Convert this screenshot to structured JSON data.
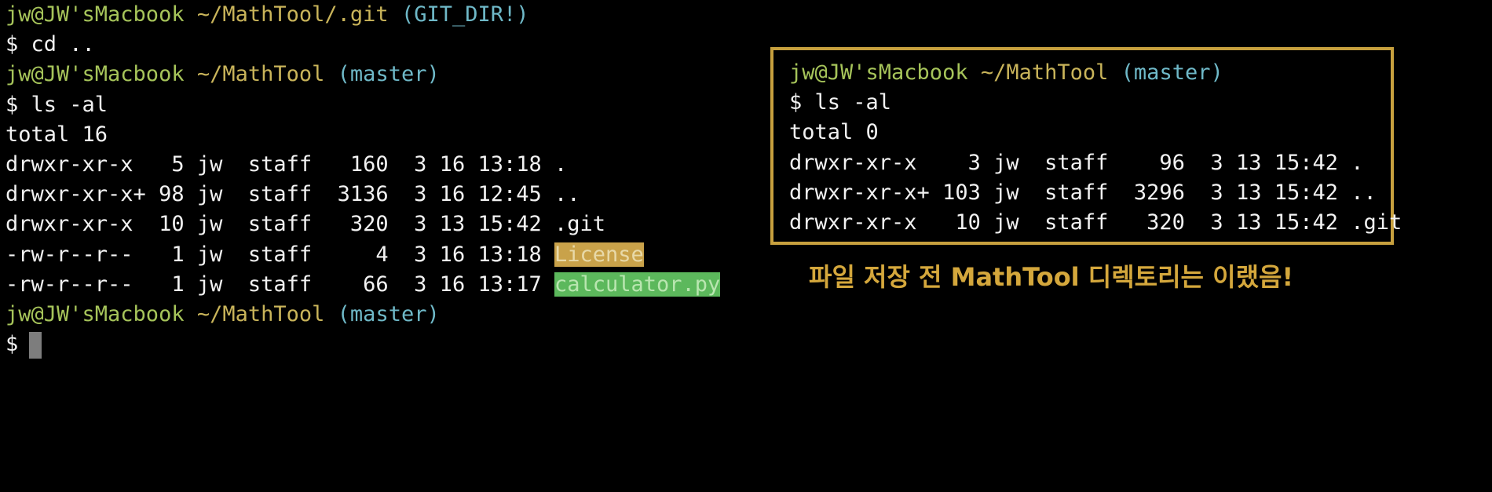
{
  "terminal": {
    "lines": [
      {
        "user": "jw@JW'sMacbook",
        "path": "~/MathTool/.git",
        "branch": "(GIT_DIR!)"
      },
      {
        "cmd": "$ cd .."
      },
      {
        "user": "jw@JW'sMacbook",
        "path": "~/MathTool",
        "branch": "(master)"
      },
      {
        "cmd": "$ ls -al"
      },
      {
        "text": "total 16"
      },
      {
        "text": "drwxr-xr-x   5 jw  staff   160  3 16 13:18 ."
      },
      {
        "text": "drwxr-xr-x+ 98 jw  staff  3136  3 16 12:45 .."
      },
      {
        "text": "drwxr-xr-x  10 jw  staff   320  3 13 15:42 .git"
      },
      {
        "prefix": "-rw-r--r--   1 jw  staff     4  3 16 13:18 ",
        "file": "License"
      },
      {
        "prefix": "-rw-r--r--   1 jw  staff    66  3 16 13:17 ",
        "file": "calculator.py"
      },
      {
        "user": "jw@JW'sMacbook",
        "path": "~/MathTool",
        "branch": "(master)"
      },
      {
        "cmd": "$"
      }
    ]
  },
  "callout": {
    "lines": [
      {
        "user": "jw@JW'sMacbook",
        "path": "~/MathTool",
        "branch": "(master)"
      },
      {
        "cmd": "$ ls -al"
      },
      {
        "text": "total 0"
      },
      {
        "text": "drwxr-xr-x    3 jw  staff    96  3 13 15:42 ."
      },
      {
        "text": "drwxr-xr-x+ 103 jw  staff  3296  3 13 15:42 .."
      },
      {
        "text": "drwxr-xr-x   10 jw  staff   320  3 13 15:42 .git"
      }
    ],
    "caption": "파일 저장 전 MathTool 디렉토리는 이랬음!"
  },
  "colors": {
    "background": "#000000",
    "prompt_user": "#a6c45a",
    "prompt_branch": "#6fb9c8",
    "callout_border": "#c7a03e",
    "caption": "#d4a73c",
    "license_highlight": "#c9a24a",
    "python_highlight": "#5cb85c"
  }
}
